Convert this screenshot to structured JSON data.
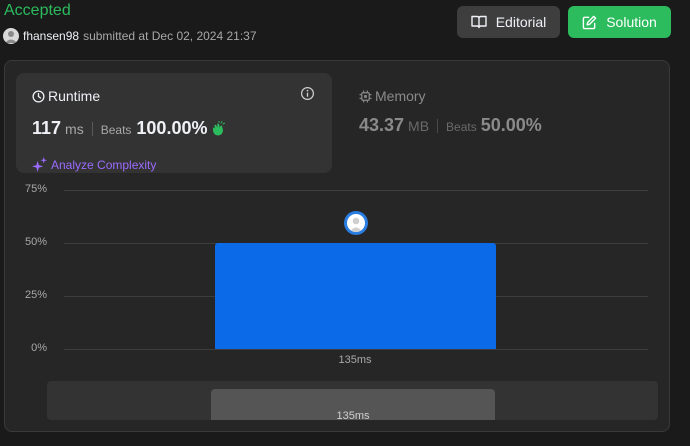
{
  "header": {
    "status": "Accepted",
    "status_color": "#2cbb5d",
    "username": "fhansen98",
    "submitted_text": "submitted at Dec 02, 2024 21:37",
    "editorial_label": "Editorial",
    "solution_label": "Solution",
    "icons": {
      "editorial": "book-icon",
      "solution": "edit-icon"
    }
  },
  "runtime": {
    "title": "Runtime",
    "value": "117",
    "unit": "ms",
    "beats_label": "Beats",
    "beats_pct": "100.00%",
    "analyze_label": "Analyze Complexity",
    "icons": {
      "title": "clock-icon",
      "info": "info-icon",
      "beats": "clapping-hands-icon",
      "analyze": "sparkle-icon"
    }
  },
  "memory": {
    "title": "Memory",
    "value": "43.37",
    "unit": "MB",
    "beats_label": "Beats",
    "beats_pct": "50.00%",
    "icons": {
      "title": "chip-icon"
    }
  },
  "chart_data": {
    "type": "bar",
    "categories": [
      "135ms"
    ],
    "values": [
      50
    ],
    "yticks": [
      "75%",
      "50%",
      "25%",
      "0%"
    ],
    "ylim": [
      0,
      75
    ],
    "grid": true,
    "bar_color": "#0a6ae8",
    "marker": "user-avatar-marker"
  },
  "scrollbar": {
    "label": "135ms"
  }
}
